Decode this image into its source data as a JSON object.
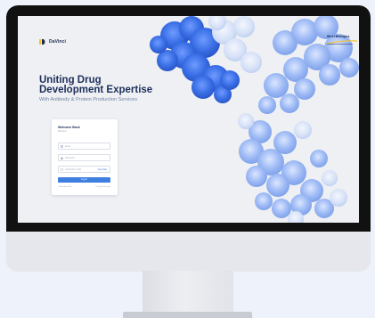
{
  "brand": {
    "name": "DaVinci",
    "logo_icon": "davinci-logo-icon",
    "accent": "#f2c230"
  },
  "partner": {
    "name": "WuXi Biologics",
    "accent": "#f2c230"
  },
  "hero": {
    "title_line1": "Uniting Drug",
    "title_line2": "Development Expertise",
    "subtitle": "With Antibody & Protein Production Services"
  },
  "login": {
    "title": "Welcome Back",
    "subtitle": "Welcome",
    "email_placeholder": "Email",
    "password_placeholder": "Password",
    "verification_placeholder": "Verification Code",
    "send_code_label": "Get Code",
    "submit_label": "Log in",
    "remember_label": "Remember Me",
    "forgot_label": "Forgot Password",
    "button_color": "#3f7fe0"
  },
  "colors": {
    "bezel": "#111111",
    "screen_bg": "#eef0f3",
    "title": "#1d2f5b",
    "molecule": "#3a6fe6"
  }
}
